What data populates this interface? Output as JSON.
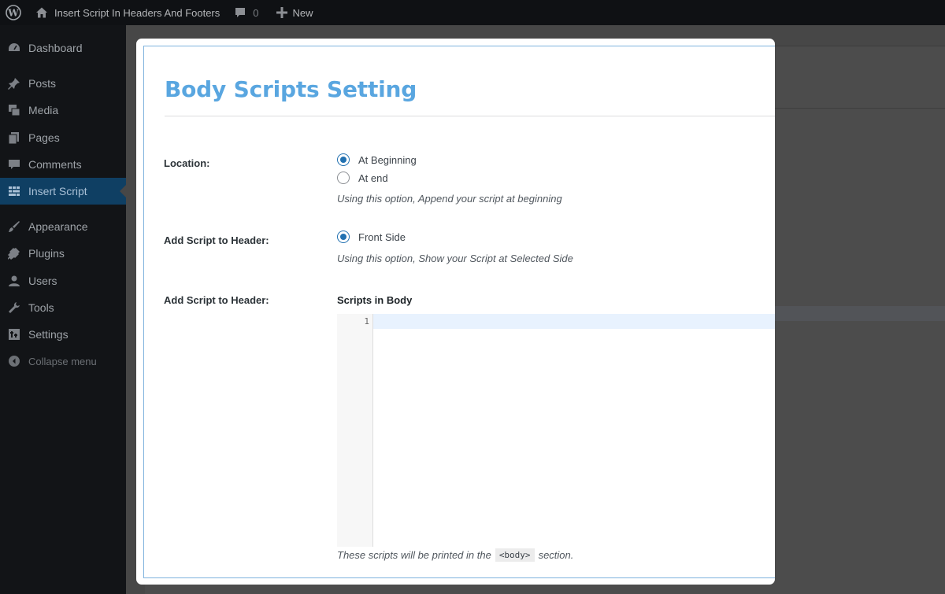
{
  "adminbar": {
    "site_name": "Insert Script In Headers And Footers",
    "comments_count": "0",
    "new_label": "New"
  },
  "sidebar": {
    "items": [
      {
        "label": "Dashboard",
        "icon": "dashboard-icon"
      },
      {
        "label": "Posts",
        "icon": "pin-icon"
      },
      {
        "label": "Media",
        "icon": "media-icon"
      },
      {
        "label": "Pages",
        "icon": "pages-icon"
      },
      {
        "label": "Comments",
        "icon": "comment-icon"
      },
      {
        "label": "Insert Script",
        "icon": "table-icon",
        "active": true
      },
      {
        "label": "Appearance",
        "icon": "brush-icon"
      },
      {
        "label": "Plugins",
        "icon": "plugin-icon"
      },
      {
        "label": "Users",
        "icon": "user-icon"
      },
      {
        "label": "Tools",
        "icon": "wrench-icon"
      },
      {
        "label": "Settings",
        "icon": "settings-icon"
      }
    ],
    "collapse_label": "Collapse menu"
  },
  "modal": {
    "title": "Body Scripts Setting",
    "location": {
      "label": "Location:",
      "options": [
        {
          "label": "At Beginning",
          "checked": true
        },
        {
          "label": "At end",
          "checked": false
        }
      ],
      "help": "Using this option, Append your script at beginning"
    },
    "side": {
      "label": "Add Script to Header:",
      "options": [
        {
          "label": "Front Side",
          "checked": true
        }
      ],
      "help": "Using this option, Show your Script at Selected Side"
    },
    "scripts": {
      "label": "Add Script to Header:",
      "editor_label": "Scripts in Body",
      "line_number": "1",
      "help_before": "These scripts will be printed in the",
      "help_code": "<body>",
      "help_after": "section."
    }
  },
  "colors": {
    "title": "#59a6e0",
    "accent": "#2271b1",
    "active_menu": "#0f3f63"
  }
}
